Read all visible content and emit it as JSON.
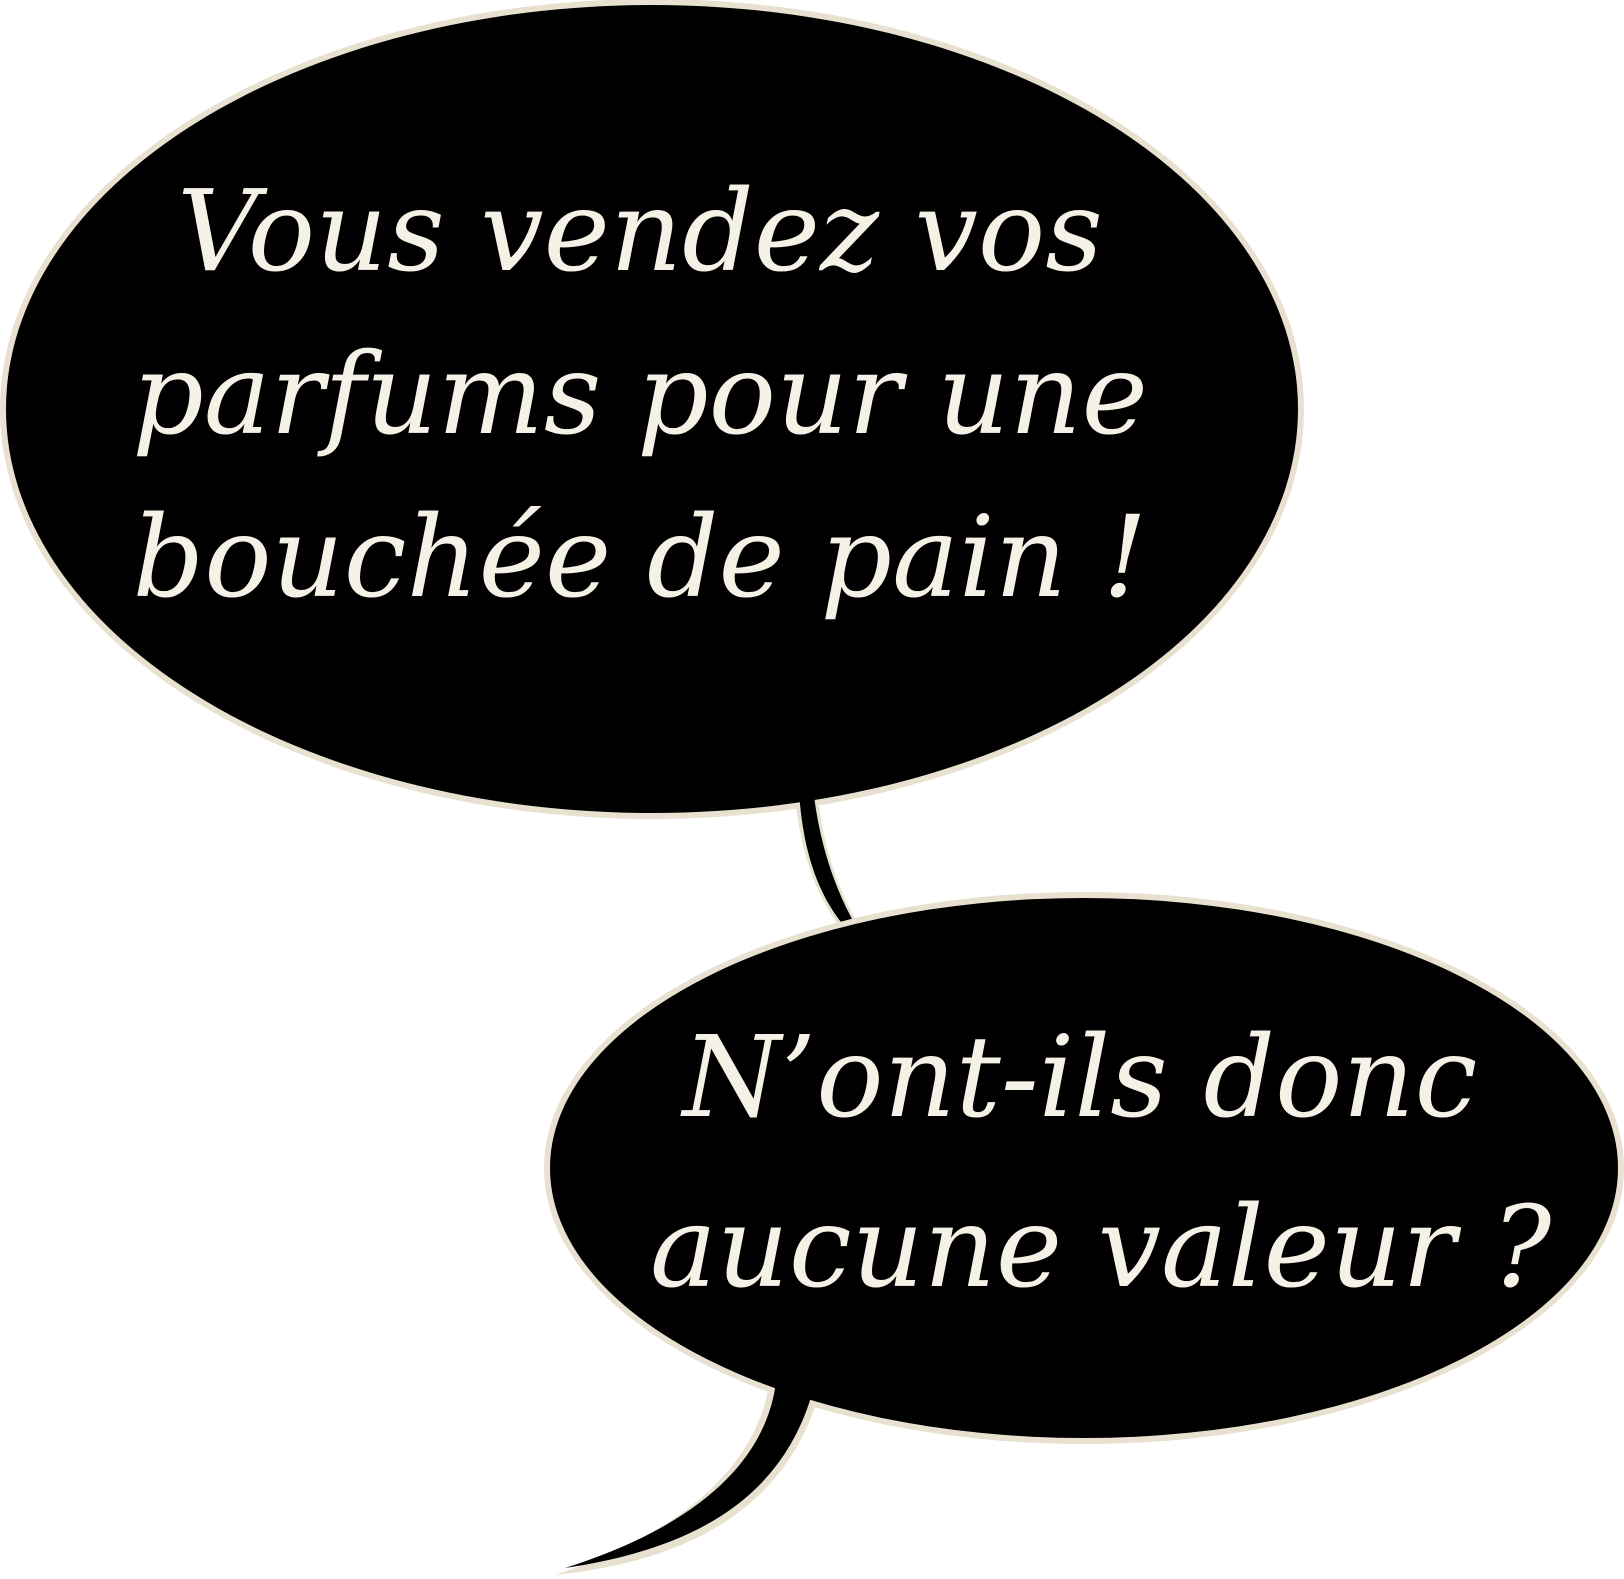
{
  "top_bubble": {
    "lines": [
      "Vous vendez vos",
      "parfums pour une",
      "bouchée de pain !"
    ]
  },
  "bottom_bubble": {
    "lines": [
      "N’ont-ils donc",
      "aucune valeur ?"
    ]
  },
  "colors": {
    "bubble_fill": "#000000",
    "bubble_outline": "#e8e1d0",
    "text": "#f6f1e6",
    "background": "#ffffff"
  }
}
